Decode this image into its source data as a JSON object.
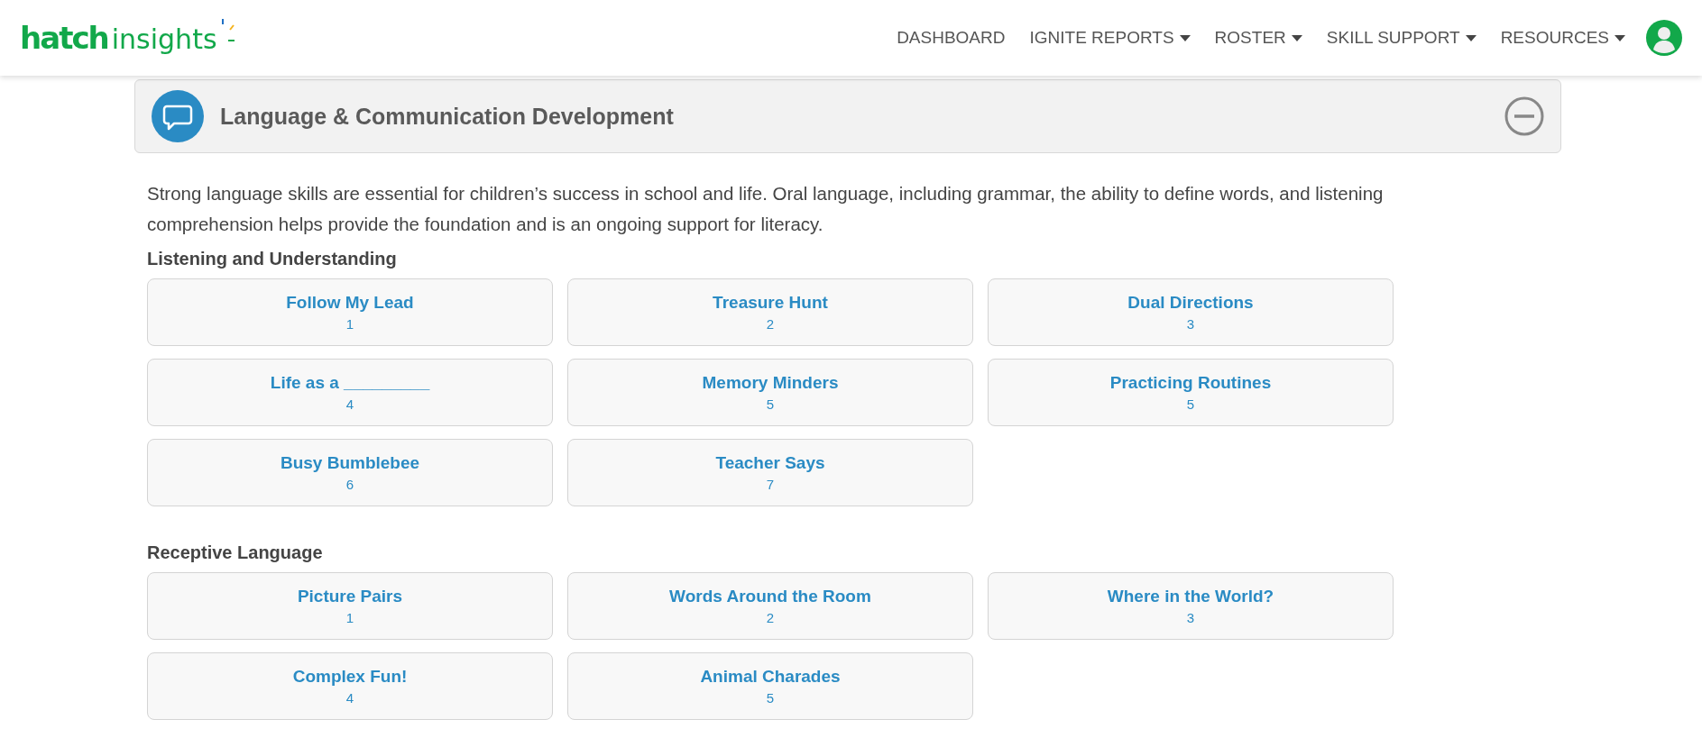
{
  "header": {
    "logo": {
      "brand": "hatch",
      "product": "insights"
    },
    "nav": [
      {
        "label": "DASHBOARD",
        "dropdown": false
      },
      {
        "label": "IGNITE REPORTS",
        "dropdown": true
      },
      {
        "label": "ROSTER",
        "dropdown": true
      },
      {
        "label": "SKILL SUPPORT",
        "dropdown": true
      },
      {
        "label": "RESOURCES",
        "dropdown": true
      }
    ]
  },
  "panel": {
    "title": "Language & Communication Development",
    "expanded": true,
    "description": "Strong language skills are essential for children’s success in school and life. Oral language, including grammar, the ability to define words, and listening comprehension helps provide the foundation and is an ongoing support for literacy.",
    "sections": [
      {
        "heading": "Listening and Understanding",
        "activities": [
          {
            "title": "Follow My Lead",
            "level": "1"
          },
          {
            "title": "Treasure Hunt",
            "level": "2"
          },
          {
            "title": "Dual Directions",
            "level": "3"
          },
          {
            "title": "Life as a _________",
            "level": "4"
          },
          {
            "title": "Memory Minders",
            "level": "5"
          },
          {
            "title": "Practicing Routines",
            "level": "5"
          },
          {
            "title": "Busy Bumblebee",
            "level": "6"
          },
          {
            "title": "Teacher Says",
            "level": "7"
          }
        ]
      },
      {
        "heading": "Receptive Language",
        "activities": [
          {
            "title": "Picture Pairs",
            "level": "1"
          },
          {
            "title": "Words Around the Room",
            "level": "2"
          },
          {
            "title": "Where in the World?",
            "level": "3"
          },
          {
            "title": "Complex Fun!",
            "level": "4"
          },
          {
            "title": "Animal Charades",
            "level": "5"
          }
        ]
      }
    ]
  }
}
